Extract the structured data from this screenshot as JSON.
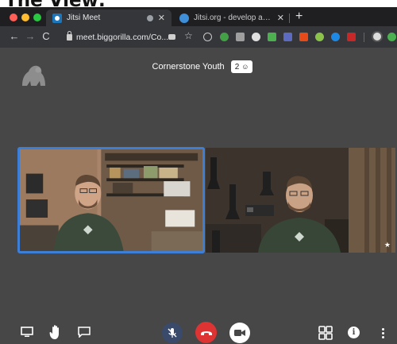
{
  "caption": "The View:",
  "browser": {
    "tabs": [
      {
        "title": "Jitsi Meet",
        "active": true
      },
      {
        "title": "Jitsi.org - develop and deploy fu",
        "active": false
      }
    ],
    "new_tab": "+",
    "url": "meet.biggorilla.com/Co...",
    "nav": {
      "back": "←",
      "forward": "→",
      "reload": "C"
    }
  },
  "meeting": {
    "room_name": "Cornerstone Youth",
    "participant_count": "2",
    "participants": [
      {
        "tile": "left",
        "active_speaker": true
      },
      {
        "tile": "right",
        "active_speaker": false
      }
    ]
  },
  "toolbar_icons": [
    "screen-share-icon",
    "raise-hand-icon",
    "chat-icon",
    "mic-muted-icon",
    "hangup-icon",
    "camera-icon",
    "tile-view-icon",
    "info-icon",
    "more-icon"
  ],
  "colors": {
    "meeting_bg": "#474747",
    "active_border": "#3d7fd7",
    "hangup": "#dd3333",
    "mic": "#3a4a6b"
  }
}
